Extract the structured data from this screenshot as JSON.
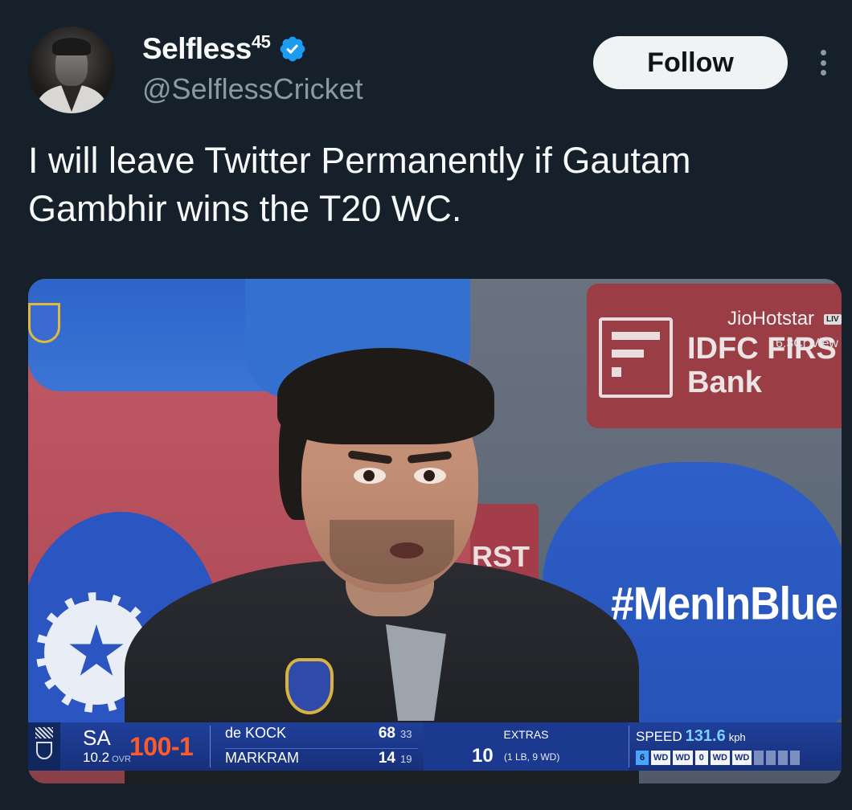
{
  "author": {
    "display_name": "Selfless",
    "display_name_sup": "45",
    "handle": "@SelflessCricket",
    "verified_icon": "verified-badge-icon",
    "verified_color": "#1d9bf0"
  },
  "actions": {
    "follow_label": "Follow",
    "more_icon": "more-vertical-icon"
  },
  "tweet": {
    "text": "I will leave Twitter Permanently if Gautam\nGambhir wins the T20 WC."
  },
  "media": {
    "broadcaster": "JioHotstar",
    "live_tag": "LIV",
    "views": "6.3Cr View",
    "sponsor_text": "IDFC FIRS\nBank",
    "board_text": "RST",
    "hashtag": "#MenInBlue",
    "scoreboard": {
      "team": "SA",
      "overs": "10.2",
      "overs_unit": "OVR",
      "score": "100-1",
      "batters": [
        {
          "name": "de KOCK",
          "runs": "68",
          "balls": "33"
        },
        {
          "name": "MARKRAM",
          "runs": "14",
          "balls": "19"
        }
      ],
      "extras_label": "EXTRAS",
      "extras_value": "10",
      "extras_detail": "(1 LB, 9 WD)",
      "speed_label": "SPEED",
      "speed_value": "131.6",
      "speed_unit": "kph",
      "this_over": [
        "6",
        "WD",
        "WD",
        "0",
        "WD",
        "WD"
      ]
    }
  },
  "colors": {
    "background": "#15202b",
    "text_primary": "#f7f9f9",
    "text_secondary": "#8b98a5",
    "score_accent": "#ff5a2b",
    "scorebar_blue": "#1f3f9a"
  }
}
